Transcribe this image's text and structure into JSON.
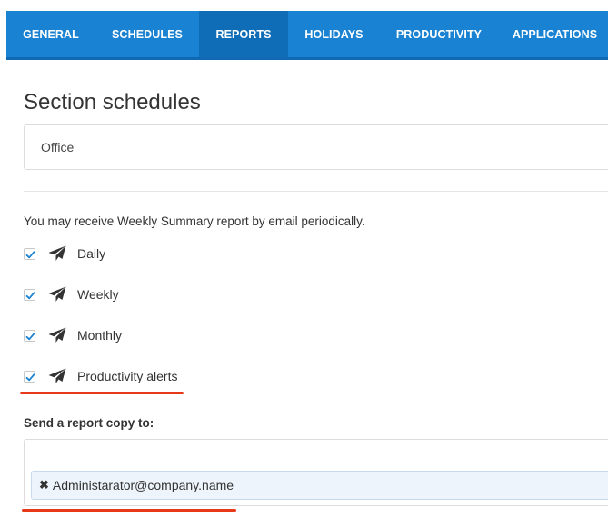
{
  "tabs": [
    {
      "label": "GENERAL",
      "active": false
    },
    {
      "label": "SCHEDULES",
      "active": false
    },
    {
      "label": "REPORTS",
      "active": true
    },
    {
      "label": "HOLIDAYS",
      "active": false
    },
    {
      "label": "PRODUCTIVITY",
      "active": false
    },
    {
      "label": "APPLICATIONS",
      "active": false
    }
  ],
  "section": {
    "title": "Section schedules",
    "input_value": "Office"
  },
  "reports": {
    "info_text": "You may receive Weekly Summary report by email periodically.",
    "options": [
      {
        "label": "Daily",
        "checked": true,
        "icon": "paper-plane-icon"
      },
      {
        "label": "Weekly",
        "checked": true,
        "icon": "paper-plane-icon"
      },
      {
        "label": "Monthly",
        "checked": true,
        "icon": "paper-plane-icon"
      },
      {
        "label": "Productivity alerts",
        "checked": true,
        "icon": "paper-plane-icon"
      }
    ]
  },
  "copy": {
    "label": "Send a report copy to:",
    "recipients": [
      {
        "email": "Administarator@company.name",
        "remove_icon": "x-icon"
      }
    ]
  },
  "colors": {
    "tabbar": "#1a82d2",
    "tab_active": "#0f6db8",
    "highlight": "#e8381a",
    "check": "#1a82d2"
  }
}
